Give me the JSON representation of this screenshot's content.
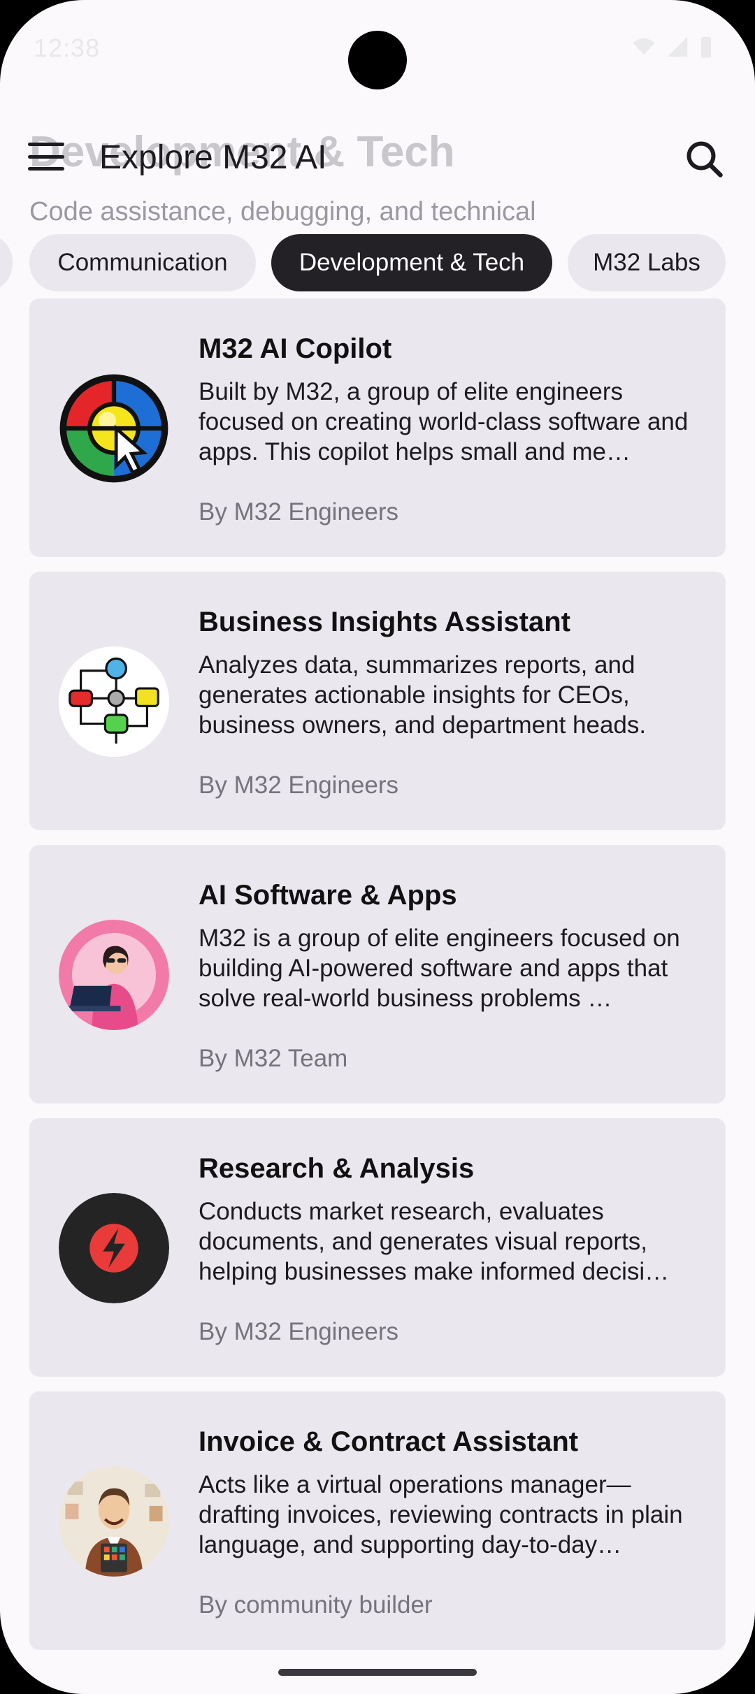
{
  "status_bar": {
    "time": "12:38"
  },
  "header": {
    "ghost_title": "Development & Tech",
    "ghost_subtitle": "Code assistance, debugging, and technical",
    "title": "Explore M32 AI"
  },
  "chips": [
    {
      "label": "Communication",
      "active": false
    },
    {
      "label": "Development & Tech",
      "active": true
    },
    {
      "label": "M32 Labs",
      "active": false
    }
  ],
  "cards": [
    {
      "title": "M32 AI Copilot",
      "description": "Built by M32, a group of elite engineers focused on creating world-class software and apps. This copilot helps small and me…",
      "author": "By M32 Engineers",
      "icon": "m32-copilot-logo-icon"
    },
    {
      "title": "Business Insights Assistant",
      "description": "Analyzes data, summarizes reports, and generates actionable insights for CEOs, business owners, and department heads.",
      "author": "By M32 Engineers",
      "icon": "flowchart-icon"
    },
    {
      "title": "AI Software & Apps",
      "description": "M32 is a group of elite engineers focused on building AI-powered software and apps that solve real-world business problems …",
      "author": "By M32 Team",
      "icon": "woman-laptop-avatar"
    },
    {
      "title": "Research & Analysis",
      "description": "Conducts market research, evaluates documents, and generates visual reports, helping businesses make informed decisi…",
      "author": "By M32 Engineers",
      "icon": "lightning-bolt-icon"
    },
    {
      "title": "Invoice & Contract Assistant",
      "description": "Acts like a virtual operations manager—drafting invoices, reviewing contracts in plain language, and supporting day-to-day…",
      "author": "By community builder",
      "icon": "man-with-tablet-avatar"
    }
  ],
  "colors": {
    "background": "#fbf9fc",
    "card": "#ebe7ee",
    "chip_active": "#232126",
    "author_text": "#76737c"
  }
}
